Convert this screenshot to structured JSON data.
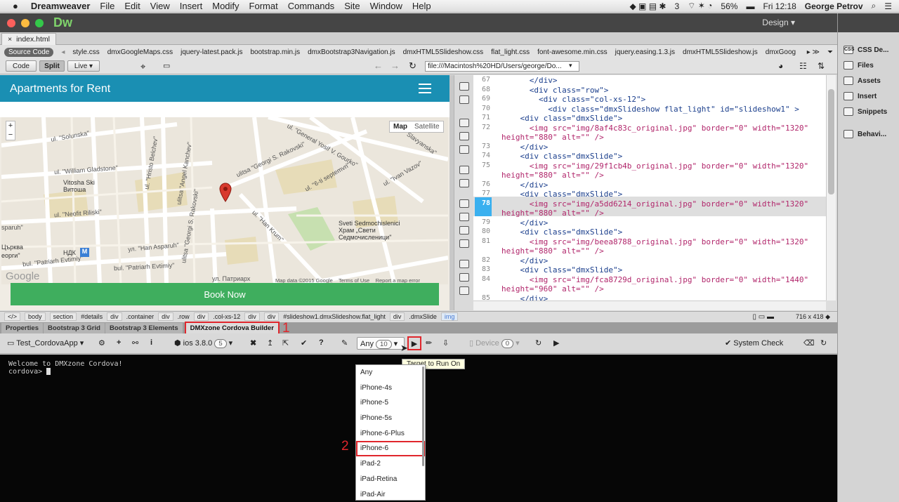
{
  "menubar": {
    "app": "Dreamweaver",
    "items": [
      "File",
      "Edit",
      "View",
      "Insert",
      "Modify",
      "Format",
      "Commands",
      "Site",
      "Window",
      "Help"
    ],
    "tray": {
      "count": "3",
      "battery": "56%",
      "clock": "Fri 12:18",
      "user": "George Petrov"
    }
  },
  "titlebar": {
    "logo": "Dw",
    "workspace": "Design"
  },
  "document": {
    "tab": "index.html"
  },
  "related": {
    "source_code": "Source Code",
    "files": [
      "style.css",
      "dmxGoogleMaps.css",
      "jquery-latest.pack.js",
      "bootstrap.min.js",
      "dmxBootstrap3Navigation.js",
      "dmxHTML5Slideshow.css",
      "flat_light.css",
      "font-awesome.min.css",
      "jquery.easing.1.3.js",
      "dmxHTML5Slideshow.js",
      "dmxGoog"
    ]
  },
  "doctoolbar": {
    "code": "Code",
    "split": "Split",
    "live": "Live",
    "url": "file:///Macintosh%20HD/Users/george/Do..."
  },
  "live": {
    "header": "Apartments for Rent",
    "map_btn": "Map",
    "satellite_btn": "Satellite",
    "zoom_in": "+",
    "zoom_out": "−",
    "labels": [
      {
        "t": "ul. \"Solunska\""
      },
      {
        "t": "ul. \"General Yosif V. Gourko\""
      },
      {
        "t": "ul. \"Slavyanska\""
      },
      {
        "t": "ul. \"William Gladstone\""
      },
      {
        "t": "ul. \"Hristo Belchev\""
      },
      {
        "t": "ulitsa \"Angel Kanchev\""
      },
      {
        "t": "ulitsa \"Georgi S. Rakovski\""
      },
      {
        "t": "ul. \"6-ti septemvri\""
      },
      {
        "t": "ul. \"Ivan Vazov\""
      },
      {
        "t": "Vitosha Ski"
      },
      {
        "t": "Витоша"
      },
      {
        "t": "ul. \"Neofit Riliski\""
      },
      {
        "t": "ul. \"Han Krum\""
      },
      {
        "t": "Sveti Sedmochislenici"
      },
      {
        "t": "Храм „Свети"
      },
      {
        "t": "Седмочисленици\""
      },
      {
        "t": "sparuh\""
      },
      {
        "t": "ул. \"Han Asparuh\""
      },
      {
        "t": "Църква"
      },
      {
        "t": "еорги\""
      },
      {
        "t": "bul. \"Patriarh Evtimiy\""
      },
      {
        "t": "bul. \"Patriarh Evtimiy\""
      },
      {
        "t": "НДК"
      },
      {
        "t": "ул. Патриарх"
      },
      {
        "t": "ulitsa \"Georgi S. Rakovski\""
      }
    ],
    "metro": "M",
    "google": "Google",
    "copyright": "Map data ©2015 Google",
    "terms": "Terms of Use",
    "report": "Report a map error",
    "book_now": "Book Now"
  },
  "code": {
    "lines": [
      {
        "n": "67",
        "t": "      </div>"
      },
      {
        "n": "68",
        "t": "      <div class=\"row\">"
      },
      {
        "n": "69",
        "t": "        <div class=\"col-xs-12\">"
      },
      {
        "n": "70",
        "t": "          <div class=\"dmxSlideshow flat_light\" id=\"slideshow1\" >"
      },
      {
        "n": "71",
        "t": "    <div class=\"dmxSlide\">"
      },
      {
        "n": "72",
        "t": "      <img src=\"img/8af4c83c_original.jpg\" border=\"0\" width=\"1320\""
      },
      {
        "n": "",
        "t": "height=\"880\" alt=\"\" />"
      },
      {
        "n": "73",
        "t": "    </div>"
      },
      {
        "n": "74",
        "t": "    <div class=\"dmxSlide\">"
      },
      {
        "n": "75",
        "t": "      <img src=\"img/29f1cb4b_original.jpg\" border=\"0\" width=\"1320\""
      },
      {
        "n": "",
        "t": "height=\"880\" alt=\"\" />"
      },
      {
        "n": "76",
        "t": "    </div>"
      },
      {
        "n": "77",
        "t": "    <div class=\"dmxSlide\">"
      },
      {
        "n": "78",
        "t": "      <img src=\"img/a5dd6214_original.jpg\" border=\"0\" width=\"1320\""
      },
      {
        "n": "",
        "t": "height=\"880\" alt=\"\" />"
      },
      {
        "n": "79",
        "t": "    </div>"
      },
      {
        "n": "80",
        "t": "    <div class=\"dmxSlide\">"
      },
      {
        "n": "81",
        "t": "      <img src=\"img/beea8788_original.jpg\" border=\"0\" width=\"1320\""
      },
      {
        "n": "",
        "t": "height=\"880\" alt=\"\" />"
      },
      {
        "n": "82",
        "t": "    </div>"
      },
      {
        "n": "83",
        "t": "    <div class=\"dmxSlide\">"
      },
      {
        "n": "84",
        "t": "      <img src=\"img/fca8729d_original.jpg\" border=\"0\" width=\"1440\""
      },
      {
        "n": "",
        "t": "height=\"960\" alt=\"\" />"
      },
      {
        "n": "85",
        "t": "    </div>"
      }
    ],
    "highlight_line": "78"
  },
  "statusbar": {
    "crumbs": [
      "</>",
      "body",
      "section",
      "#details",
      "div",
      ".container",
      "div",
      ".row",
      "div",
      ".col-xs-12",
      "div",
      "div",
      "#slideshow1.dmxSlideshow.flat_light",
      "div",
      ".dmxSlide",
      "img"
    ],
    "window_size": "716 x 418 ◆"
  },
  "panels": {
    "tabs": [
      "Properties",
      "Bootstrap 3 Grid",
      "Bootstrap 3 Elements",
      "DMXzone Cordova Builder"
    ],
    "active": 3
  },
  "cordova": {
    "project": "Test_CordovaApp",
    "platform": "ios 3.8.0",
    "platform_count": "5",
    "target": "Any",
    "target_count": "10",
    "device": "Device",
    "device_count": "0",
    "system_check": "System Check",
    "tooltip": "Target to Run On"
  },
  "terminal": {
    "line1": "Welcome to DMXzone Cordova!",
    "prompt": "cordova> "
  },
  "dropdown": {
    "options": [
      "Any",
      "iPhone-4s",
      "iPhone-5",
      "iPhone-5s",
      "iPhone-6-Plus",
      "iPhone-6",
      "iPad-2",
      "iPad-Retina",
      "iPad-Air"
    ],
    "selected": 5
  },
  "right_panel": {
    "items": [
      "CSS De...",
      "Files",
      "Assets",
      "Insert",
      "Snippets",
      "Behavi..."
    ]
  },
  "markers": {
    "m1": "1",
    "m2": "2",
    "m3": "3"
  },
  "colors": {
    "accent": "#e0262c",
    "header": "#1a8fb3",
    "book": "#3fae5e",
    "terminal": "#060606"
  }
}
